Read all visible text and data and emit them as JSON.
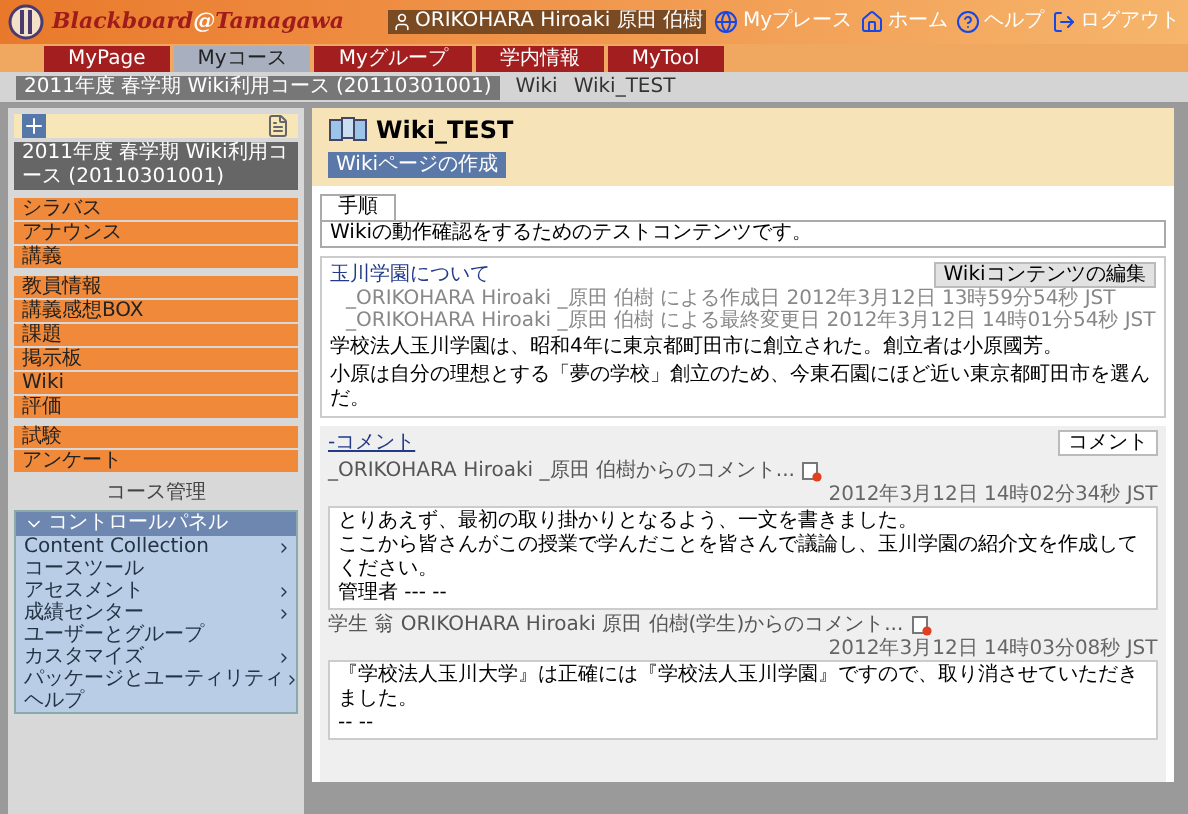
{
  "header": {
    "logo_main": "Blackboard",
    "logo_at": "@",
    "logo_sub": "Tamagawa",
    "user": "ORIKOHARA Hiroaki 原田 伯樹",
    "links": [
      {
        "kind": "place",
        "label": "Myプレース"
      },
      {
        "kind": "home",
        "label": "ホーム"
      },
      {
        "kind": "help",
        "label": "ヘルプ"
      },
      {
        "kind": "logout",
        "label": "ログアウト"
      }
    ]
  },
  "tabs": [
    {
      "label": "MyPage",
      "selected": false
    },
    {
      "label": "Myコース",
      "selected": true
    },
    {
      "label": "Myグループ",
      "selected": false
    },
    {
      "label": "学内情報",
      "selected": false
    },
    {
      "label": "MyTool",
      "selected": false
    }
  ],
  "breadcrumb": {
    "course": "2011年度 春学期 Wiki利用コース (20110301001)",
    "items": [
      "Wiki",
      "Wiki_TEST"
    ]
  },
  "sidebar": {
    "course_title": "2011年度 春学期 Wiki利用コース (20110301001)",
    "groups": [
      [
        "シラバス",
        "アナウンス",
        "講義"
      ],
      [
        "教員情報",
        "講義感想BOX",
        "課題",
        "掲示板",
        "Wiki",
        "評価"
      ],
      [
        "試験",
        "アンケート"
      ]
    ],
    "manage_label": "コース管理",
    "control_panel": {
      "title": "コントロールパネル",
      "expanded": true,
      "items": [
        {
          "label": "Content Collection",
          "expandable": true
        },
        {
          "label": "コースツール",
          "expandable": false
        },
        {
          "label": "アセスメント",
          "expandable": true
        },
        {
          "label": "成績センター",
          "expandable": true
        },
        {
          "label": "ユーザーとグループ",
          "expandable": false
        },
        {
          "label": "カスタマイズ",
          "expandable": true
        },
        {
          "label": "パッケージとユーティリティ",
          "expandable": true
        },
        {
          "label": "ヘルプ",
          "expandable": false
        }
      ]
    }
  },
  "main": {
    "title": "Wiki_TEST",
    "create_button": "Wikiページの作成",
    "info_tabs": [
      {
        "label": "手順",
        "selected": true
      }
    ],
    "description": "Wikiの動作確認をするためのテストコンテンツです。",
    "page": {
      "title": "玉川学園について",
      "edit_button": "Wikiコンテンツの編集",
      "meta": [
        "_ORIKOHARA Hiroaki _原田 伯樹 による作成日 2012年3月12日 13時59分54秒 JST",
        "_ORIKOHARA Hiroaki _原田 伯樹 による最終変更日 2012年3月12日 14時01分54秒 JST"
      ],
      "body": [
        "学校法人玉川学園は、昭和4年に東京都町田市に創立された。創立者は小原國芳。",
        "小原は自分の理想とする「夢の学校」創立のため、今東石園にほど近い東京都町田市を選んだ。"
      ]
    },
    "comments_toggle": "-コメント",
    "comment_button": "コメント",
    "comments": [
      {
        "author": "_ORIKOHARA Hiroaki _原田 伯樹からのコメント...",
        "date": "2012年3月12日 14時02分34秒 JST",
        "body": [
          "とりあえず、最初の取り掛かりとなるよう、一文を書きました。",
          "ここから皆さんがこの授業で学んだことを皆さんで議論し、玉川学園の紹介文を作成してください。",
          "管理者 --- --"
        ]
      },
      {
        "author": "学生 翁 ORIKOHARA Hiroaki 原田 伯樹(学生)からのコメント...",
        "date": "2012年3月12日 14時03分08秒 JST",
        "body": [
          "『学校法人玉川大学』は正確には『学校法人玉川学園』ですので、取り消させていただきました。",
          "-- --"
        ]
      }
    ]
  }
}
